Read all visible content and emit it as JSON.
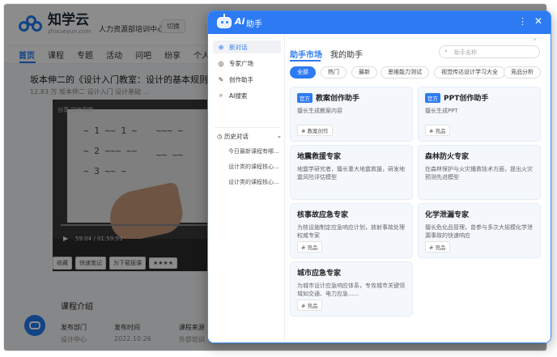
{
  "site": {
    "logo_cn": "知学云",
    "logo_en": "zhixueyun.com",
    "org": "人力资源部培训中心",
    "switch_label": "切换",
    "nav": [
      "首页",
      "课程",
      "专题",
      "活动",
      "问吧",
      "纷享",
      "个人"
    ],
    "course_title": "坂本伸二的《设计入门教室：设计的基本规则》",
    "course_meta": "12.83 万   坂本伸二   设计入门   设计基础   ...",
    "video_time": "59:04 / 01:59:59",
    "video_top": "分享   同步观看",
    "actions": [
      "收藏",
      "快速笔记",
      "为下载报课",
      "★★★★"
    ],
    "intro_title": "课程介绍",
    "intro": [
      {
        "label": "发布部门",
        "value": "设计中心"
      },
      {
        "label": "发布时间",
        "value": "2022.10.26"
      },
      {
        "label": "课程来源",
        "value": "外部培训"
      }
    ]
  },
  "assistant": {
    "ai_mark": "Ai",
    "title": "助手",
    "more_icon": "more-icon",
    "close_icon": "close-icon",
    "sidebar": [
      {
        "label": "新对话",
        "icon": "chat-plus-icon",
        "active": true
      },
      {
        "label": "专家广场",
        "icon": "eye-icon"
      },
      {
        "label": "创作助手",
        "icon": "pen-icon"
      },
      {
        "label": "AI搜索",
        "icon": "search-icon"
      }
    ],
    "history_label": "历史对话",
    "history": [
      "今日最新课程有哪...",
      "设计类的课程核心...",
      "设计类的课程核心..."
    ],
    "tabs": [
      "助手市场",
      "我的助手"
    ],
    "search_placeholder": "助手名称",
    "chips": [
      "全部",
      "热门",
      "最新",
      "思维能力测试",
      "视觉传达设计学习大全",
      "竞品分析"
    ],
    "cards": [
      {
        "badge": "官方",
        "title": "教案创作助手",
        "desc": "擅长生成教案内容",
        "tag": "# 教案创作"
      },
      {
        "badge": "官方",
        "title": "PPT创作助手",
        "desc": "擅长生成PPT",
        "tag": "# 竞品"
      },
      {
        "badge": "",
        "title": "地震救援专家",
        "desc": "地震学研究者，擅长重大地震救援，研发地震风险评估模型",
        "tag": "# 竞品"
      },
      {
        "badge": "",
        "title": "森林防火专家",
        "desc": "在森林保护与火灾播救技术方面，提出火灾预测先进模型",
        "tag": "# 竞品"
      },
      {
        "badge": "",
        "title": "核事故应急专家",
        "desc": "为核设施制定应急响应计划，放射事故处理权威专家",
        "tag": "# 竞品"
      },
      {
        "badge": "",
        "title": "化学泄漏专家",
        "desc": "擅长危化品管理，曾参与多次大规模化学泄漏事故的快速响应",
        "tag": "# 竞品"
      },
      {
        "badge": "",
        "title": "城市应急专家",
        "desc": "为城市设计应急响应体系，专攻城市关键领域如交通、电力应急......",
        "tag": "# 竞品"
      }
    ]
  }
}
